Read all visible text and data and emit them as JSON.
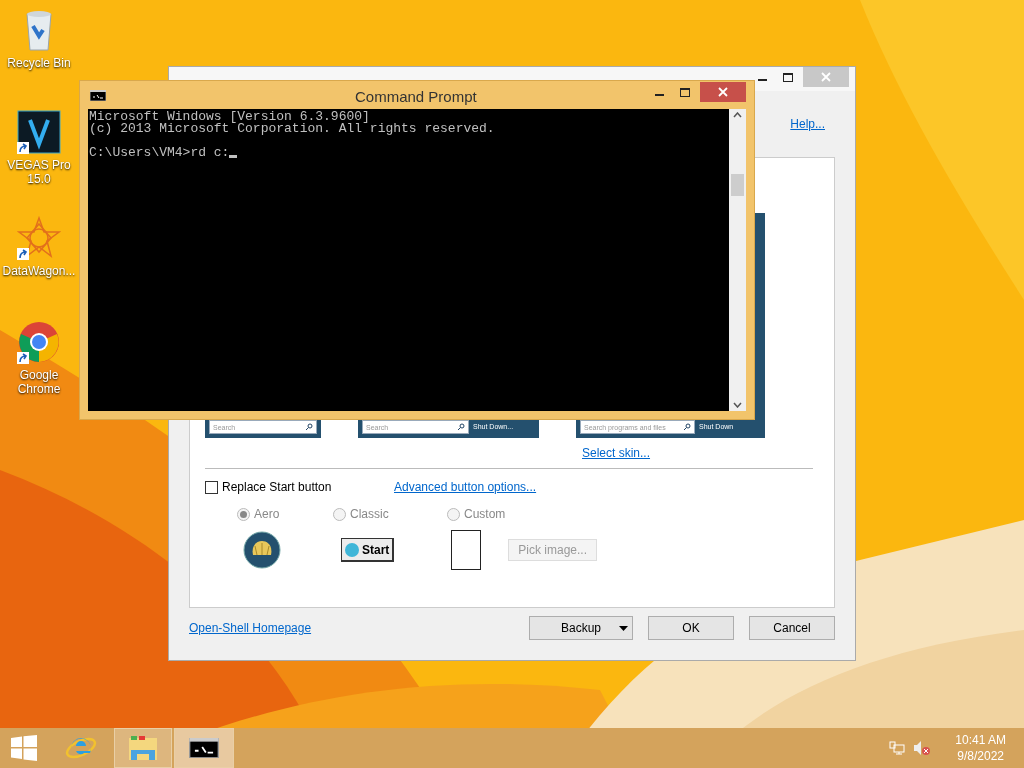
{
  "desktop_icons": [
    {
      "kind": "recycle",
      "label": "Recycle Bin"
    },
    {
      "kind": "vegas",
      "label": "VEGAS Pro 15.0"
    },
    {
      "kind": "datawagon",
      "label": "DataWagon..."
    },
    {
      "kind": "chrome",
      "label": "Google Chrome"
    }
  ],
  "settings_window": {
    "help_link": "Help...",
    "skin_previews": [
      {
        "search": "Search"
      },
      {
        "search": "Search",
        "shutdown": "Shut Down..."
      },
      {
        "search": "Search programs and files",
        "shutdown": "Shut Down"
      }
    ],
    "select_skin_link": "Select skin...",
    "replace_start": {
      "label": "Replace Start button",
      "checked": false
    },
    "advanced_link": "Advanced button options...",
    "button_styles": [
      {
        "kind": "aero",
        "label": "Aero",
        "selected": true,
        "disabled": true
      },
      {
        "kind": "classic",
        "label": "Classic",
        "selected": false,
        "disabled": true
      },
      {
        "kind": "custom",
        "label": "Custom",
        "selected": false,
        "disabled": true
      }
    ],
    "classic_start_label": "Start",
    "pick_image": {
      "label": "Pick image...",
      "disabled": true
    },
    "homepage_link": "Open-Shell Homepage",
    "buttons": [
      {
        "kind": "menu",
        "label": "Backup"
      },
      {
        "kind": "plain",
        "label": "OK"
      },
      {
        "kind": "plain",
        "label": "Cancel"
      }
    ]
  },
  "cmd_window": {
    "title": "Command Prompt",
    "lines": [
      "Microsoft Windows [Version 6.3.9600]",
      "(c) 2013 Microsoft Corporation. All rights reserved."
    ],
    "prompt": "C:\\Users\\VM4>rd c:"
  },
  "taskbar": {
    "items": [
      {
        "kind": "start",
        "running": false,
        "active": false
      },
      {
        "kind": "ie",
        "running": false,
        "active": false
      },
      {
        "kind": "explorer",
        "running": true,
        "active": false
      },
      {
        "kind": "cmd",
        "running": true,
        "active": true
      }
    ],
    "clock": {
      "time": "10:41 AM",
      "date": "9/8/2022"
    }
  }
}
